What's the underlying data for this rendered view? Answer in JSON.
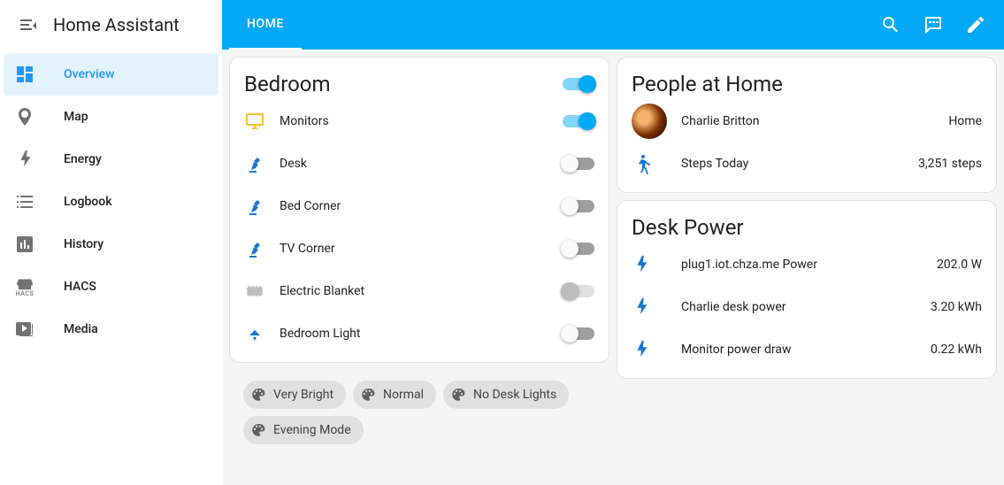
{
  "app": {
    "title": "Home Assistant"
  },
  "sidebar": {
    "items": [
      {
        "label": "Overview"
      },
      {
        "label": "Map"
      },
      {
        "label": "Energy"
      },
      {
        "label": "Logbook"
      },
      {
        "label": "History"
      },
      {
        "label": "HACS"
      },
      {
        "label": "Media"
      }
    ]
  },
  "header": {
    "tab": "HOME"
  },
  "bedroom": {
    "title": "Bedroom",
    "master_on": true,
    "entities": [
      {
        "name": "Monitors",
        "on": true,
        "kind": "monitor"
      },
      {
        "name": "Desk",
        "on": false,
        "kind": "lamp"
      },
      {
        "name": "Bed Corner",
        "on": false,
        "kind": "lamp"
      },
      {
        "name": "TV Corner",
        "on": false,
        "kind": "lamp"
      },
      {
        "name": "Electric Blanket",
        "on": false,
        "kind": "radiator",
        "disabled": true
      },
      {
        "name": "Bedroom Light",
        "on": false,
        "kind": "ceiling"
      }
    ],
    "scenes": [
      "Very Bright",
      "Normal",
      "No Desk Lights",
      "Evening Mode"
    ]
  },
  "people": {
    "title": "People at Home",
    "person": {
      "name": "Charlie Britton",
      "state": "Home"
    },
    "steps": {
      "label": "Steps Today",
      "value": "3,251 steps"
    }
  },
  "desk_power": {
    "title": "Desk Power",
    "sensors": [
      {
        "name": "plug1.iot.chza.me Power",
        "value": "202.0 W"
      },
      {
        "name": "Charlie desk power",
        "value": "3.20 kWh"
      },
      {
        "name": "Monitor power draw",
        "value": "0.22 kWh"
      }
    ]
  }
}
